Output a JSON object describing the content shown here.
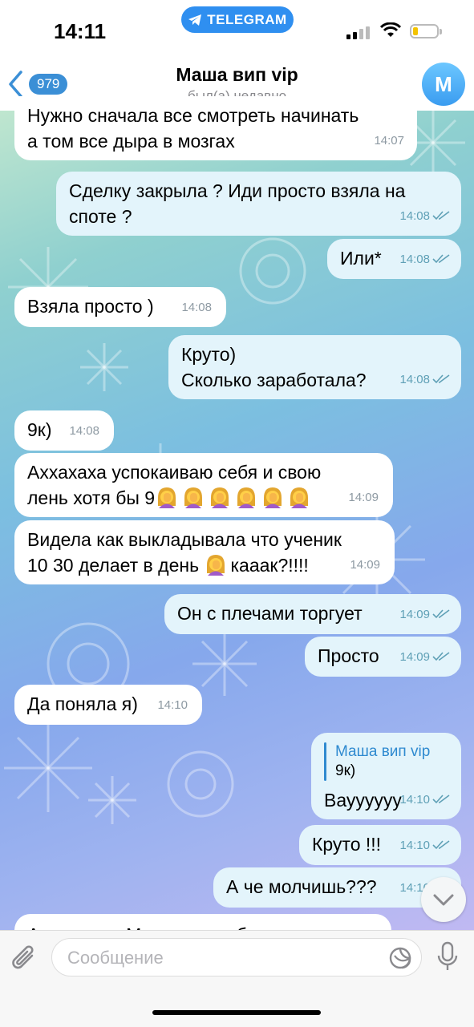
{
  "status_bar": {
    "time": "14:11",
    "app_pill": "TELEGRAM"
  },
  "header": {
    "back_count": "979",
    "contact_name": "Маша вип vip",
    "last_seen": "был(а) недавно",
    "avatar_letter": "М"
  },
  "messages": [
    {
      "dir": "in",
      "lines": [
        "Нужно сначала все смотреть начинать",
        "а том все дыра в мозгах"
      ],
      "time": "14:07"
    },
    {
      "dir": "out",
      "lines": [
        "Сделку закрыла ? Иди просто взяла на",
        "споте ?"
      ],
      "time": "14:08",
      "read": true
    },
    {
      "dir": "out",
      "lines": [
        "Или*"
      ],
      "time": "14:08",
      "read": true
    },
    {
      "dir": "in",
      "lines": [
        "Взяла просто )"
      ],
      "time": "14:08"
    },
    {
      "dir": "out",
      "lines": [
        "Круто)",
        "Сколько заработала?"
      ],
      "time": "14:08",
      "read": true
    },
    {
      "dir": "in",
      "lines": [
        "9к)"
      ],
      "time": "14:08"
    },
    {
      "dir": "in",
      "lines": [
        "Аххахаха успокаиваю себя и свою",
        "лень хотя бы 9"
      ],
      "time": "14:09",
      "emoji": "woman-facepalming-emoji",
      "emoji_count": 6
    },
    {
      "dir": "in",
      "lines": [
        "Видела как выкладывала что ученик",
        "10 30 делает в день",
        "кааак?!!!!"
      ],
      "time": "14:09",
      "emoji": "woman-facepalming-emoji",
      "emoji_count": 1
    },
    {
      "dir": "out",
      "lines": [
        "Он с плечами торгует"
      ],
      "time": "14:09",
      "read": true
    },
    {
      "dir": "out",
      "lines": [
        "Просто"
      ],
      "time": "14:09",
      "read": true
    },
    {
      "dir": "in",
      "lines": [
        "Да поняла я)"
      ],
      "time": "14:10"
    },
    {
      "dir": "out",
      "reply": {
        "name": "Маша вип vip",
        "text": "9к)"
      },
      "lines": [
        "Вауууууу"
      ],
      "time": "14:10",
      "read": true
    },
    {
      "dir": "out",
      "lines": [
        "Круто !!!"
      ],
      "time": "14:10",
      "read": true
    },
    {
      "dir": "out",
      "lines": [
        "А че молчишь???"
      ],
      "time": "14:10",
      "read": true
    },
    {
      "dir": "in",
      "lines": [
        "А тренинге Мария даже без них не"
      ],
      "time": ""
    }
  ],
  "input": {
    "placeholder": "Сообщение"
  },
  "colors": {
    "accent": "#3b8fd6",
    "outgoing_bubble": "#e3f7e9",
    "incoming_bubble": "#ffffff",
    "tick": "#5fa0b6"
  }
}
